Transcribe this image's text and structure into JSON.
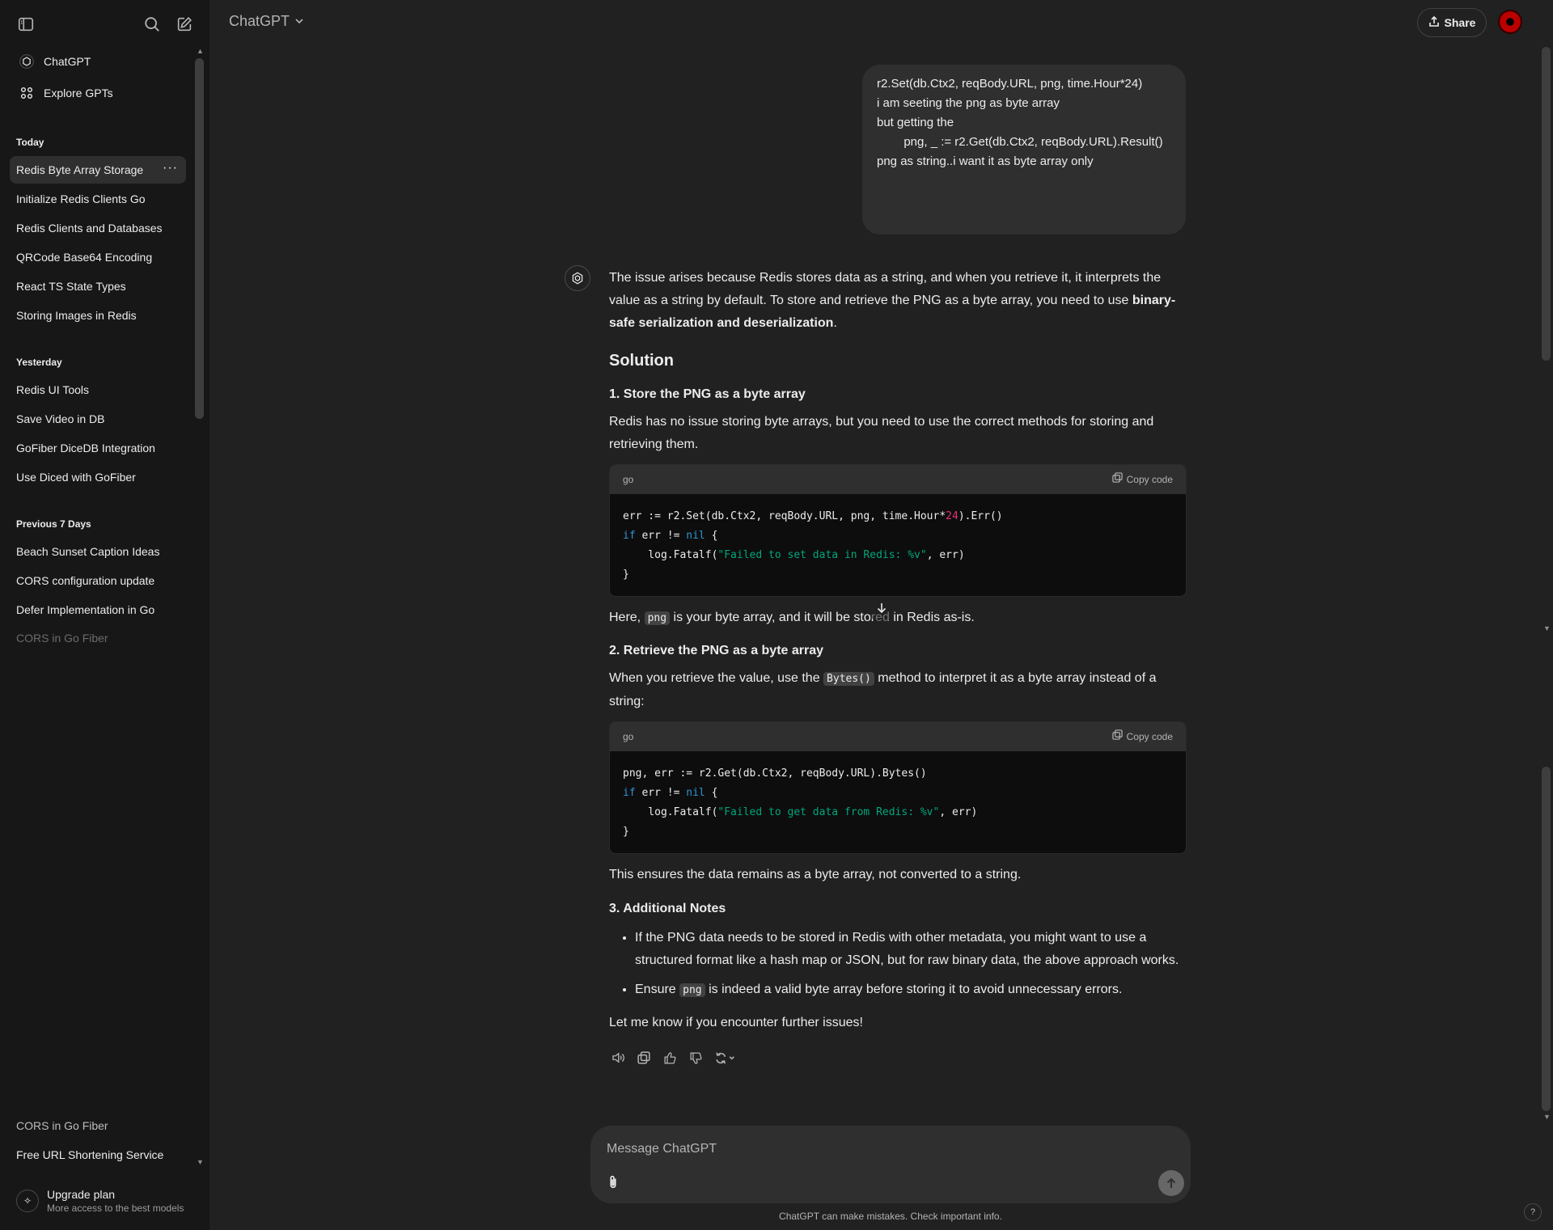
{
  "sidebar": {
    "nav": [
      {
        "label": "ChatGPT",
        "icon": "openai-logo-icon"
      },
      {
        "label": "Explore GPTs",
        "icon": "grid-icon"
      }
    ],
    "sections": [
      {
        "label": "Today",
        "items": [
          "Redis Byte Array Storage",
          "Initialize Redis Clients Go",
          "Redis Clients and Databases",
          "QRCode Base64 Encoding",
          "React TS State Types",
          "Storing Images in Redis"
        ]
      },
      {
        "label": "Yesterday",
        "items": [
          "Redis UI Tools",
          "Save Video in DB",
          "GoFiber DiceDB Integration",
          "Use Diced with GoFiber"
        ]
      },
      {
        "label": "Previous 7 Days",
        "items": [
          "Beach Sunset Caption Ideas",
          "CORS configuration update",
          "Defer Implementation in Go",
          "CORS in Go Fiber"
        ]
      }
    ],
    "bottom_items": [
      "CORS in Go Fiber",
      "Free URL Shortening Service"
    ],
    "upgrade": {
      "title": "Upgrade plan",
      "subtitle": "More access to the best models"
    }
  },
  "header": {
    "model": "ChatGPT",
    "share_label": "Share"
  },
  "user_message": {
    "lines": [
      "r2.Set(db.Ctx2, reqBody.URL, png, time.Hour*24)",
      "",
      "i am seeting the png as byte array",
      "",
      "but getting the",
      "        png, _ := r2.Get(db.Ctx2, reqBody.URL).Result()",
      "",
      "png as string..i want it as byte array only"
    ]
  },
  "assistant": {
    "intro_1": "The issue arises because Redis stores data as a string, and when you retrieve it, it interprets the value as a string by default. To store and retrieve the PNG as a byte array, you need to use ",
    "intro_bold": "binary-safe serialization and deserialization",
    "intro_end": ".",
    "solution_heading": "Solution",
    "step1_heading": "1. Store the PNG as a byte array",
    "step1_text": "Redis has no issue storing byte arrays, but you need to use the correct methods for storing and retrieving them.",
    "code1": {
      "lang": "go",
      "copy_label": "Copy code",
      "l1_a": "err := r2.Set(db.Ctx2, reqBody.URL, png, time.Hour*",
      "l1_num": "24",
      "l1_b": ").Err()",
      "l2_kw1": "if",
      "l2_a": " err != ",
      "l2_kw2": "nil",
      "l2_b": " {",
      "l3_a": "    log.Fatalf(",
      "l3_str": "\"Failed to set data in Redis: %v\"",
      "l3_b": ", err)",
      "l4": "}"
    },
    "here_1": "Here, ",
    "here_code": "png",
    "here_2": " is your byte array, and it will be stored in Redis as-is.",
    "step2_heading": "2. Retrieve the PNG as a byte array",
    "step2_1": "When you retrieve the value, use the ",
    "step2_code": "Bytes()",
    "step2_2": " method to interpret it as a byte array instead of a string:",
    "code2": {
      "lang": "go",
      "copy_label": "Copy code",
      "l1": "png, err := r2.Get(db.Ctx2, reqBody.URL).Bytes()",
      "l2_kw1": "if",
      "l2_a": " err != ",
      "l2_kw2": "nil",
      "l2_b": " {",
      "l3_a": "    log.Fatalf(",
      "l3_str": "\"Failed to get data from Redis: %v\"",
      "l3_b": ", err)",
      "l4": "}"
    },
    "ensures": "This ensures the data remains as a byte array, not converted to a string.",
    "step3_heading": "3. Additional Notes",
    "bullet1": "If the PNG data needs to be stored in Redis with other metadata, you might want to use a structured format like a hash map or JSON, but for raw binary data, the above approach works.",
    "bullet2_1": "Ensure ",
    "bullet2_code": "png",
    "bullet2_2": " is indeed a valid byte array before storing it to avoid unnecessary errors.",
    "closing": "Let me know if you encounter further issues!"
  },
  "composer": {
    "placeholder": "Message ChatGPT",
    "disclaimer": "ChatGPT can make mistakes. Check important info.",
    "help": "?"
  }
}
